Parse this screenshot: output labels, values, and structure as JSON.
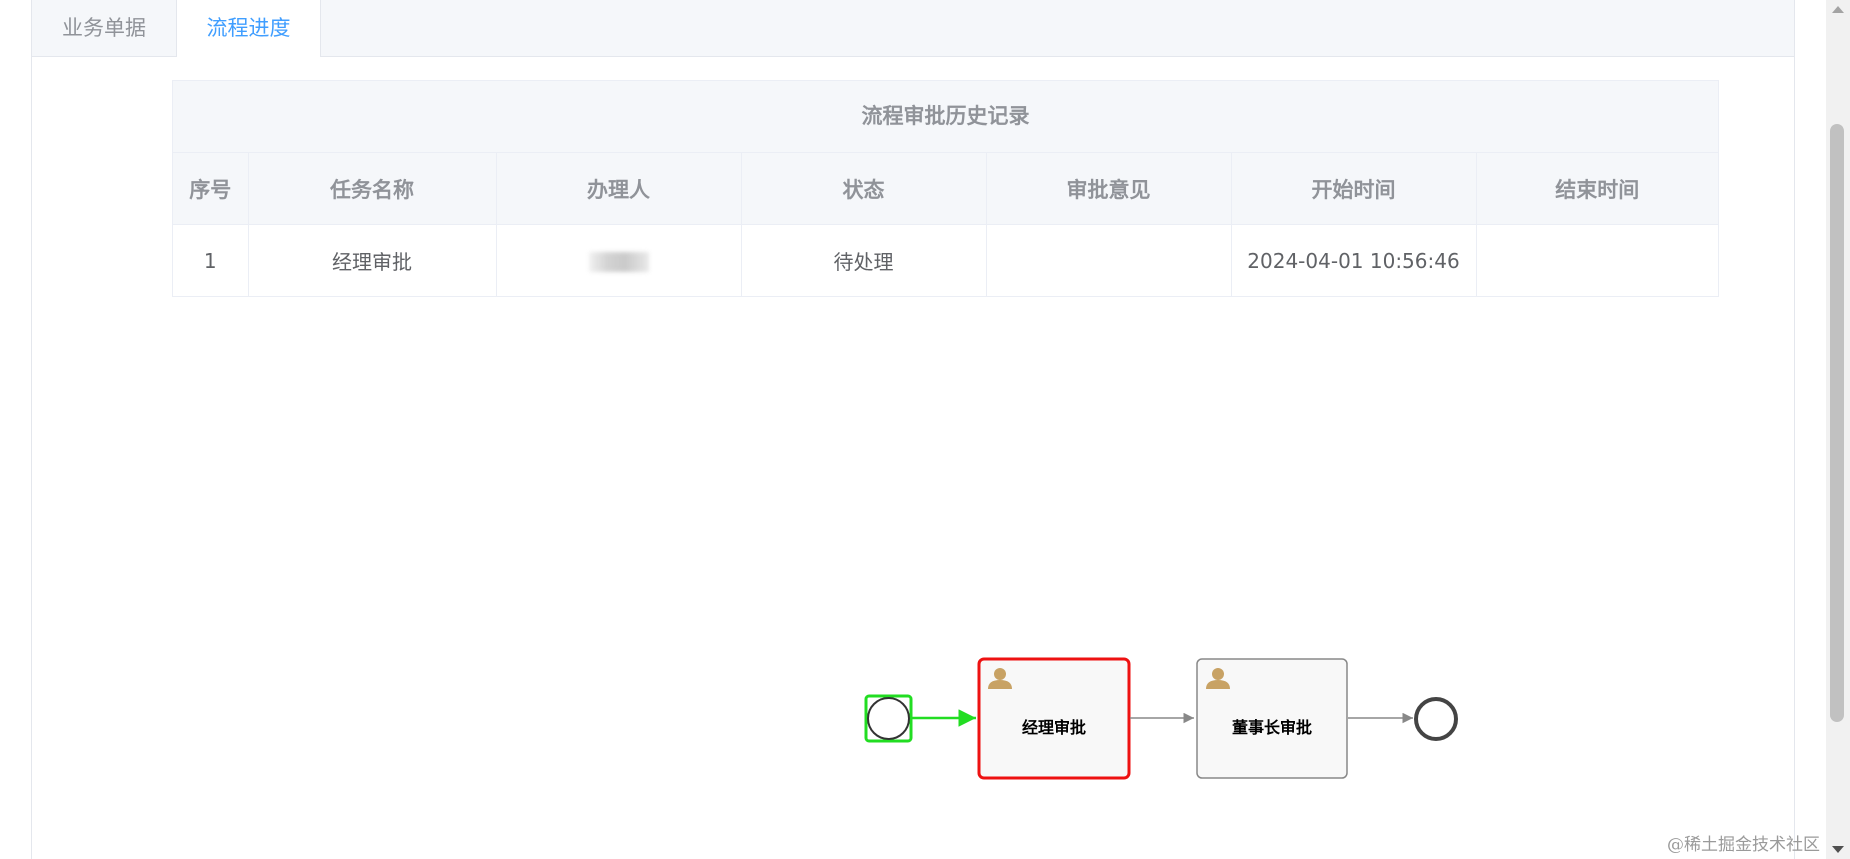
{
  "tabs": [
    {
      "label": "业务单据",
      "active": false
    },
    {
      "label": "流程进度",
      "active": true
    }
  ],
  "history": {
    "title": "流程审批历史记录",
    "columns": [
      "序号",
      "任务名称",
      "办理人",
      "状态",
      "审批意见",
      "开始时间",
      "结束时间"
    ],
    "rows": [
      {
        "index": "1",
        "task": "经理审批",
        "assignee": "",
        "status": "待处理",
        "comment": "",
        "start": "2024-04-01 10:56:46",
        "end": ""
      }
    ]
  },
  "diagram": {
    "tasks": [
      {
        "label": "经理审批",
        "state": "current"
      },
      {
        "label": "董事长审批",
        "state": "pending"
      }
    ],
    "colors": {
      "completed": "#22dd22",
      "current": "#ee1111",
      "pending": "#888888",
      "user_icon": "#c8a264"
    },
    "icons": [
      "user-icon"
    ]
  },
  "watermark": "@稀土掘金技术社区"
}
